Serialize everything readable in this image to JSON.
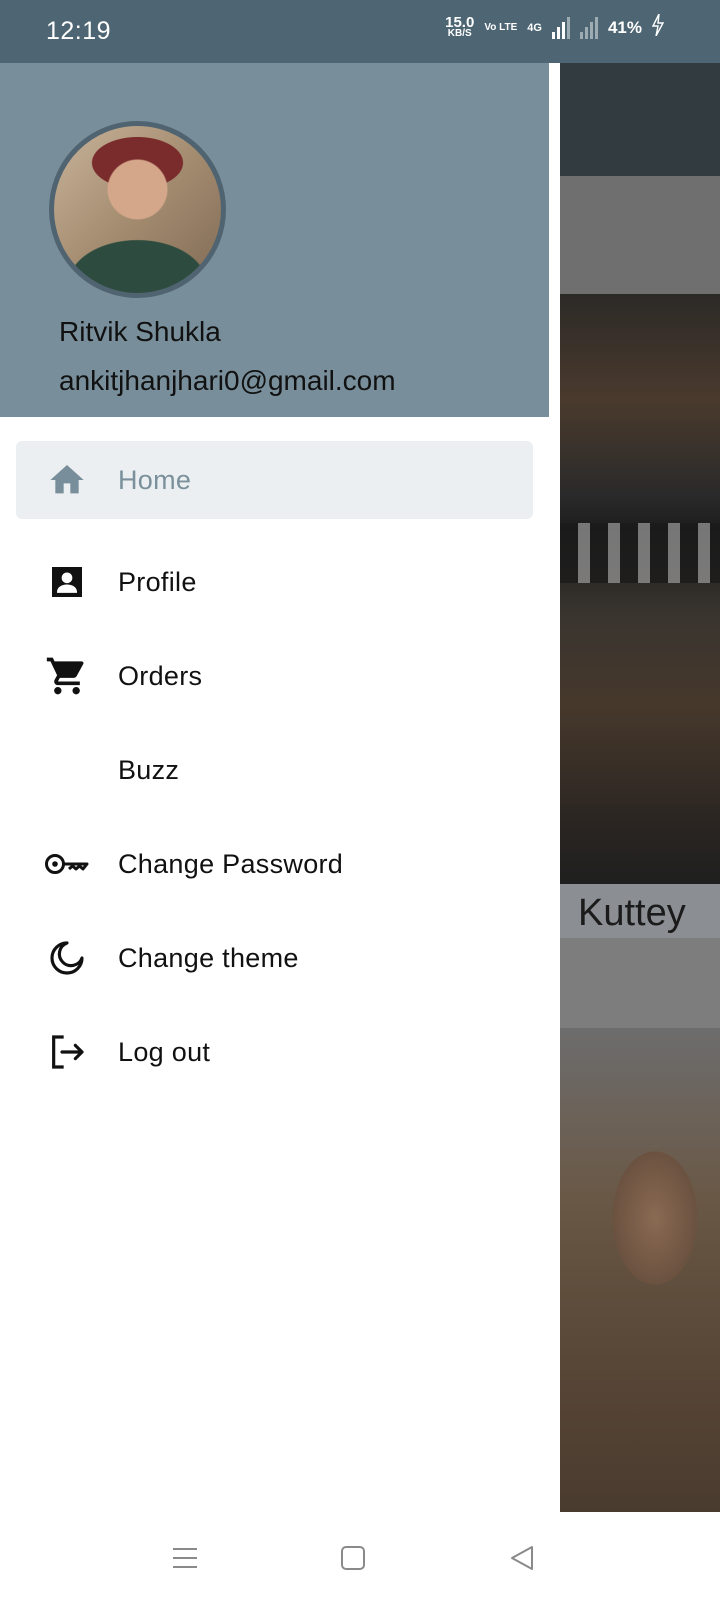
{
  "status_bar": {
    "time": "12:19",
    "speed_value": "15.0",
    "speed_unit": "KB/S",
    "volte": "Vo LTE",
    "network": "4G",
    "battery": "41%"
  },
  "drawer": {
    "user_name": "Ritvik Shukla",
    "user_email": "ankitjhanjhari0@gmail.com",
    "items": [
      {
        "label": "Home",
        "icon": "home-icon",
        "active": true
      },
      {
        "label": "Profile",
        "icon": "profile-icon",
        "active": false
      },
      {
        "label": "Orders",
        "icon": "cart-icon",
        "active": false
      },
      {
        "label": "Buzz",
        "icon": "",
        "active": false
      },
      {
        "label": "Change Password",
        "icon": "key-icon",
        "active": false
      },
      {
        "label": "Change theme",
        "icon": "moon-icon",
        "active": false
      },
      {
        "label": "Log out",
        "icon": "logout-icon",
        "active": false
      }
    ],
    "active_color": "#788f9b",
    "header_color": "#788f9b"
  },
  "background": {
    "movie_caption": "Kuttey"
  },
  "nav_bar": {
    "buttons": [
      "menu",
      "home",
      "back"
    ]
  }
}
